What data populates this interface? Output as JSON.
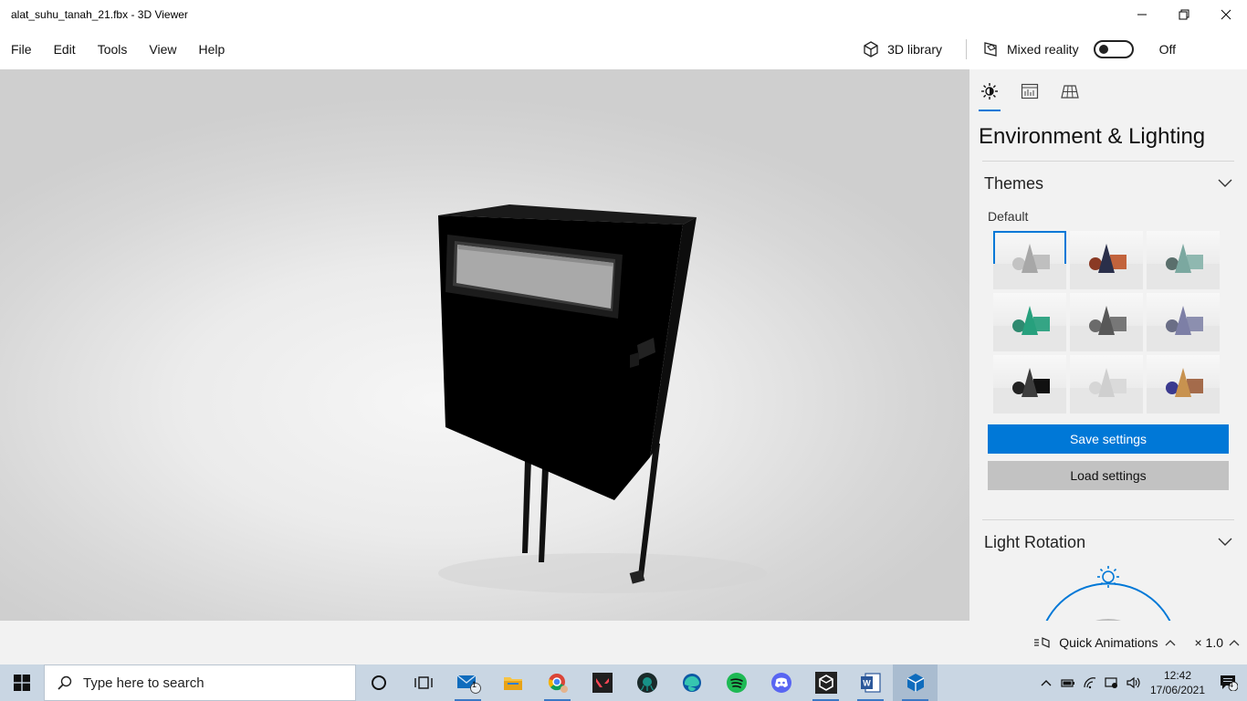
{
  "window": {
    "title": "alat_suhu_tanah_21.fbx - 3D Viewer"
  },
  "menu": {
    "items": [
      "File",
      "Edit",
      "Tools",
      "View",
      "Help"
    ],
    "library_label": "3D library",
    "mixed_reality_label": "Mixed reality",
    "mixed_reality_state": "Off"
  },
  "panel": {
    "tabs": [
      "environment-tab",
      "stats-tab",
      "grid-tab"
    ],
    "title": "Environment & Lighting",
    "themes": {
      "label": "Themes",
      "selected_name": "Default"
    },
    "save_label": "Save settings",
    "load_label": "Load settings",
    "light_rotation_label": "Light Rotation"
  },
  "status": {
    "animations_label": "Quick Animations",
    "speed": "× 1.0"
  },
  "taskbar": {
    "search_placeholder": "Type here to search",
    "mail_badge": "1",
    "time": "12:42",
    "date": "17/06/2021",
    "notification_count": "4"
  },
  "colors": {
    "accent": "#0078d7",
    "panel_bg": "#f2f2f2",
    "taskbar_bg": "#c9d6e3"
  }
}
